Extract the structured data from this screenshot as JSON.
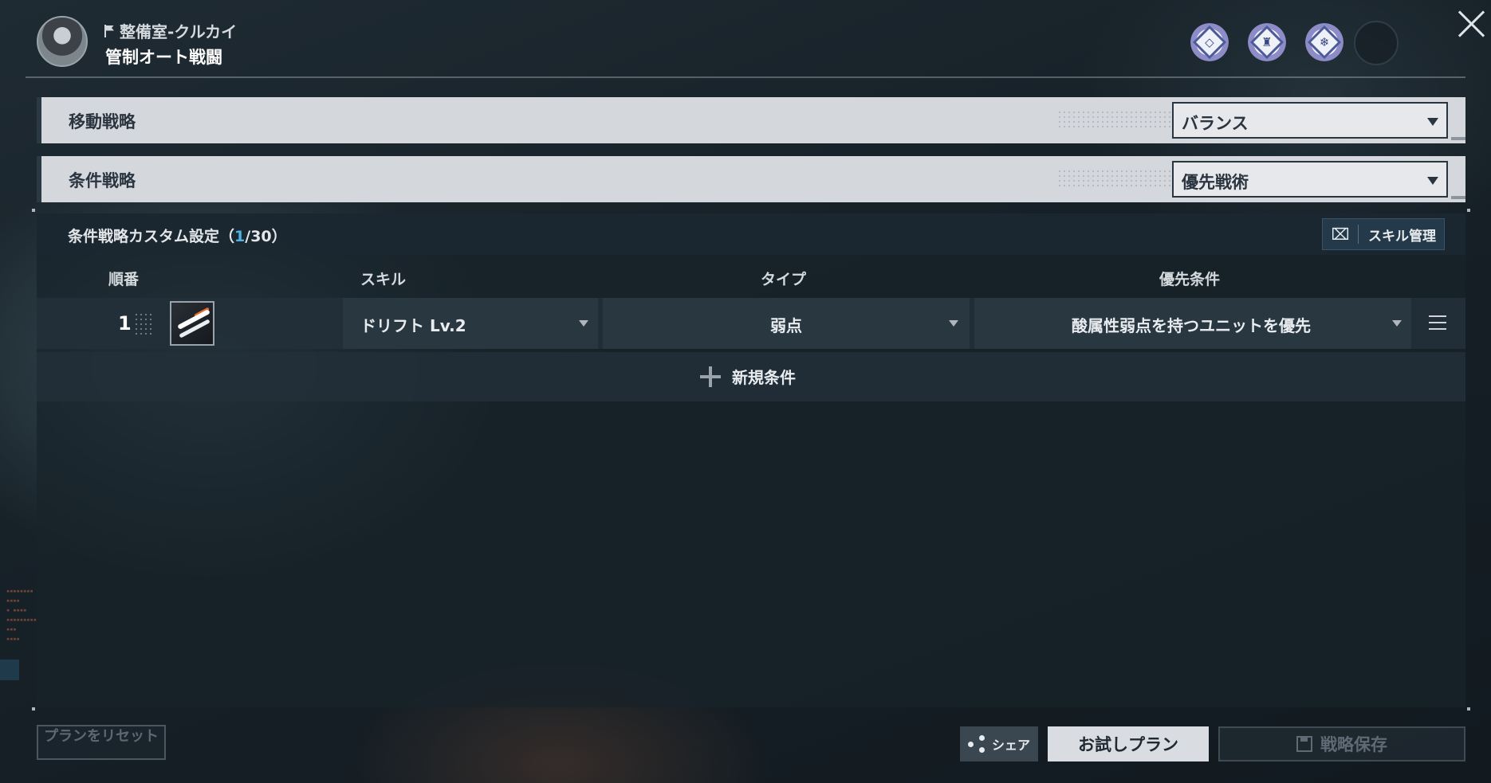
{
  "header": {
    "location": "整備室-クルカイ",
    "title": "管制オート戦闘",
    "badges": [
      {
        "icon": "diamond-emblem-icon",
        "glyph": "◇"
      },
      {
        "icon": "crest-emblem-icon",
        "glyph": "♜"
      },
      {
        "icon": "snowflake-emblem-icon",
        "glyph": "❄"
      }
    ]
  },
  "strategies": {
    "move": {
      "label": "移動戦略",
      "value": "バランス"
    },
    "condition": {
      "label": "条件戦略",
      "value": "優先戦術"
    }
  },
  "panel": {
    "title_prefix": "条件戦略カスタム設定（",
    "count": "1",
    "title_suffix": "/30）",
    "skill_management": "スキル管理",
    "columns": {
      "order": "順番",
      "skill": "スキル",
      "type": "タイプ",
      "priority": "優先条件"
    },
    "rows": [
      {
        "order": "1",
        "skill": "ドリフト Lv.2",
        "type": "弱点",
        "priority": "酸属性弱点を持つユニットを優先"
      }
    ],
    "add_condition": "新規条件"
  },
  "footer": {
    "reset": "プランをリセット",
    "share": "シェア",
    "trial": "お試しプラン",
    "save": "戦略保存"
  },
  "colors": {
    "accent": "#4fb3e6",
    "bar": "#d4d7dc",
    "panel": "#18222a"
  }
}
